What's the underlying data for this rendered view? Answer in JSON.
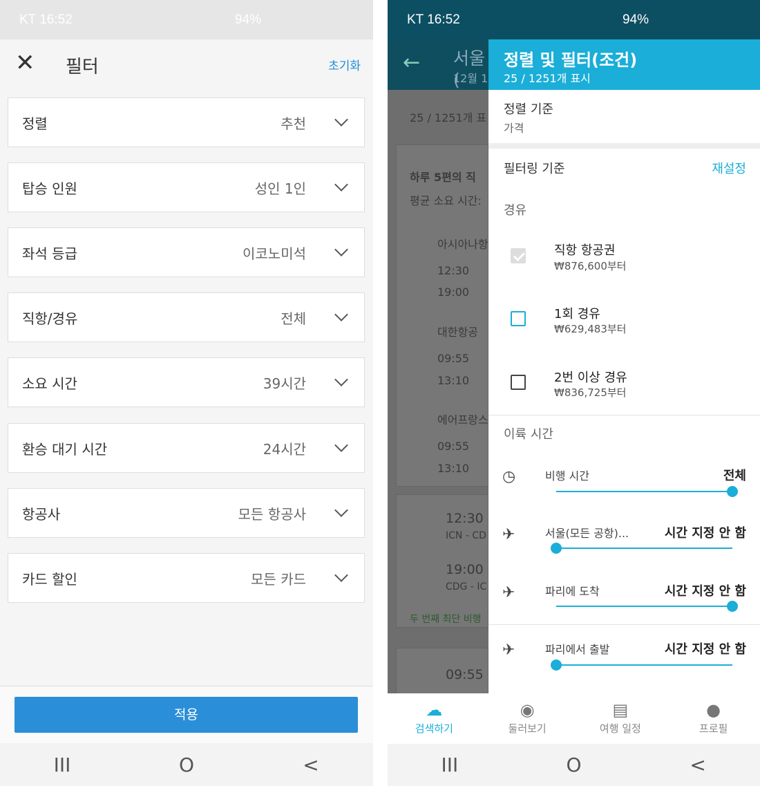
{
  "left": {
    "status_time": "KT 16:52",
    "status_right": "94%",
    "header": {
      "close_icon": "close-icon",
      "title": "필터",
      "reset": "초기화"
    },
    "filters": [
      {
        "label": "정렬",
        "value": "추천"
      },
      {
        "label": "탑승 인원",
        "value": "성인 1인"
      },
      {
        "label": "좌석 등급",
        "value": "이코노미석"
      },
      {
        "label": "직항/경유",
        "value": "전체"
      },
      {
        "label": "소요 시간",
        "value": "39시간"
      },
      {
        "label": "환승 대기 시간",
        "value": "24시간"
      },
      {
        "label": "항공사",
        "value": "모든 항공사"
      },
      {
        "label": "카드 할인",
        "value": "모든 카드"
      }
    ],
    "apply": "적용",
    "nav": [
      "III",
      "O",
      "<"
    ]
  },
  "right": {
    "status_time": "KT 16:52",
    "status_right": "94%",
    "bg": {
      "title": "서울(",
      "date": "12월 1",
      "count": "25 / 1251개 표",
      "summary1": "하루 5편의 직",
      "summary2": "평균 소요 시간:",
      "airline1": "아시아나항",
      "t1": "12:30",
      "t2": "19:00",
      "airline2": "대한항공",
      "t3": "09:55",
      "t4": "13:10",
      "airline3": "에어프랑스",
      "t5": "09:55",
      "t6": "13:10",
      "c1_time": "12:30 -",
      "c1_route": "ICN - CD",
      "c2_time": "19:00 -",
      "c2_route": "CDG - IC",
      "c_note": "두 번째 최단 비행",
      "c3_time": "09:55 -"
    },
    "drawer": {
      "title": "정렬 및 필터(조건)",
      "subtitle": "25 / 1251개 표시",
      "sort_label": "정렬 기준",
      "sort_value": "가격",
      "filter_label": "필터링 기준",
      "reset": "재설정",
      "stops_label": "경유",
      "stops": [
        {
          "name": "직항 항공권",
          "price": "₩876,600부터",
          "state": "disabled-checked"
        },
        {
          "name": "1회 경유",
          "price": "₩629,483부터",
          "state": "focused"
        },
        {
          "name": "2번 이상 경유",
          "price": "₩836,725부터",
          "state": "unchecked"
        }
      ],
      "takeoff_label": "이륙 시간",
      "sliders": [
        {
          "label": "비행 시간",
          "value": "전체",
          "icon": "clock-icon",
          "level": 1.0
        },
        {
          "label": "서울(모든 공항)...",
          "value": "시간 지정 안 함",
          "icon": "plane-depart-icon",
          "level": 0.0
        },
        {
          "label": "파리에 도착",
          "value": "시간 지정 안 함",
          "icon": "plane-arrive-icon",
          "level": 1.0
        },
        {
          "label": "파리에서 출발",
          "value": "시간 지정 안 함",
          "icon": "plane-depart-icon",
          "level": 0.0
        }
      ]
    },
    "tabs": [
      {
        "label": "검색하기",
        "icon": "search-cloud-icon"
      },
      {
        "label": "둘러보기",
        "icon": "compass-icon"
      },
      {
        "label": "여행 일정",
        "icon": "itinerary-icon"
      },
      {
        "label": "프로필",
        "icon": "profile-icon"
      }
    ],
    "nav": [
      "III",
      "O",
      "<"
    ]
  },
  "colors": {
    "accent": "#1aaed8",
    "apply": "#2a8fd8",
    "reset_link": "#1d8ed6"
  }
}
